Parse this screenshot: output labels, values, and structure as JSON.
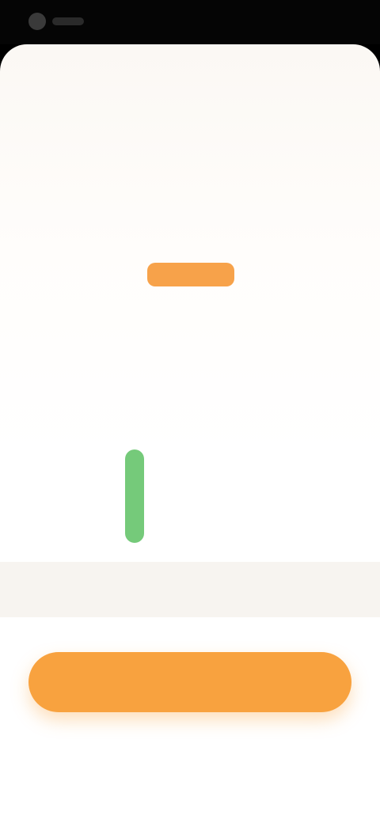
{
  "statusBar": {
    "time": "",
    "icon": "dot-icon"
  },
  "colors": {
    "accent": "#F8A23F",
    "badge": "#F7A24A",
    "success": "#66C46B",
    "sheet": "#FFFFFF",
    "sheetTop": "#FBF8F4",
    "priceRow": "#F7F4F0"
  },
  "main": {
    "badge_label": "",
    "title_line_1": "",
    "title_line_2": "",
    "subtitle": "",
    "checklist": {
      "items": [
        "",
        "",
        "",
        ""
      ]
    },
    "price": {
      "left": "",
      "right": ""
    },
    "cta_label": "",
    "footer": {
      "left": "",
      "right": ""
    }
  }
}
